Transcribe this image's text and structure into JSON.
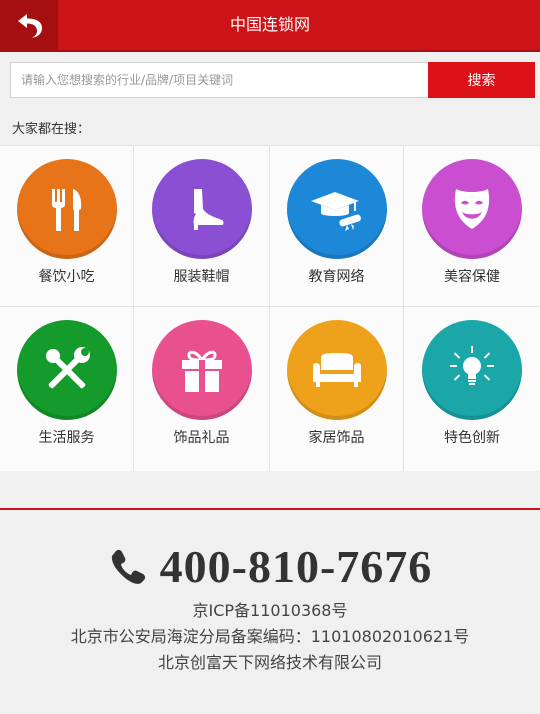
{
  "header": {
    "title": "中国连锁网",
    "back_icon": "back-arrow-icon"
  },
  "search": {
    "placeholder": "请输入您想搜索的行业/品牌/项目关键词",
    "button_label": "搜索"
  },
  "hot_label": "大家都在搜：",
  "categories": [
    {
      "label": "餐饮小吃",
      "icon": "fork-knife-icon",
      "color": "#e8741a"
    },
    {
      "label": "服装鞋帽",
      "icon": "high-heel-icon",
      "color": "#8a4fd3"
    },
    {
      "label": "教育网络",
      "icon": "graduation-cap-icon",
      "color": "#1e88d8"
    },
    {
      "label": "美容保健",
      "icon": "mask-icon",
      "color": "#c94fd0"
    },
    {
      "label": "生活服务",
      "icon": "tools-icon",
      "color": "#159a2c"
    },
    {
      "label": "饰品礼品",
      "icon": "gift-icon",
      "color": "#e8508e"
    },
    {
      "label": "家居饰品",
      "icon": "sofa-icon",
      "color": "#eea21c"
    },
    {
      "label": "特色创新",
      "icon": "lightbulb-icon",
      "color": "#1ba7a8"
    }
  ],
  "footer": {
    "phone_icon": "phone-icon",
    "phone": "400-810-7676",
    "icp": "京ICP备11010368号",
    "police": "北京市公安局海淀分局备案编码：11010802010621号",
    "company": "北京创富天下网络技术有限公司"
  },
  "colors": {
    "brand_red": "#cc1418",
    "button_red": "#dd1218"
  }
}
